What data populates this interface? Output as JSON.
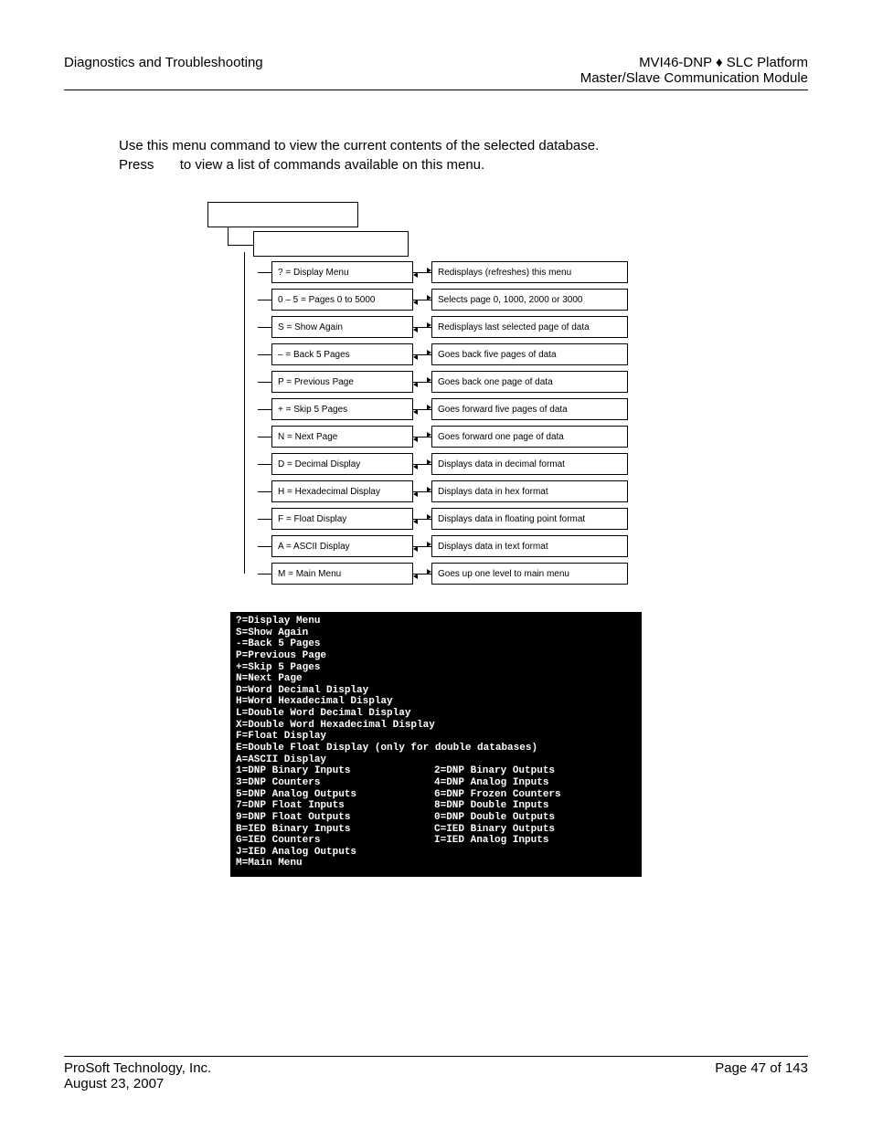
{
  "header": {
    "left": "Diagnostics and Troubleshooting",
    "right_line1": "MVI46-DNP ♦ SLC Platform",
    "right_line2": "Master/Slave Communication Module"
  },
  "intro": {
    "line1": "Use this menu command to view the current contents of the selected database.",
    "line2a": "Press ",
    "line2b": " to view a list of commands available on this menu."
  },
  "menu_rows": [
    {
      "cmd": "? = Display Menu",
      "desc": "Redisplays (refreshes) this menu"
    },
    {
      "cmd": "0 – 5 = Pages 0 to 5000",
      "desc": "Selects page 0, 1000, 2000 or 3000"
    },
    {
      "cmd": "S = Show Again",
      "desc": "Redisplays last selected page of data"
    },
    {
      "cmd": "– = Back 5 Pages",
      "desc": "Goes back five pages of data"
    },
    {
      "cmd": "P = Previous Page",
      "desc": "Goes back one page of data"
    },
    {
      "cmd": "+ = Skip 5 Pages",
      "desc": "Goes forward five pages of data"
    },
    {
      "cmd": "N = Next Page",
      "desc": "Goes forward one page of data"
    },
    {
      "cmd": "D = Decimal Display",
      "desc": "Displays data in decimal format"
    },
    {
      "cmd": "H = Hexadecimal Display",
      "desc": "Displays data in hex format"
    },
    {
      "cmd": "F = Float Display",
      "desc": "Displays data in floating point format"
    },
    {
      "cmd": "A = ASCII Display",
      "desc": "Displays data in text format"
    },
    {
      "cmd": "M = Main Menu",
      "desc": "Goes up one level to main menu"
    }
  ],
  "terminal": {
    "top_lines": [
      "?=Display Menu",
      "S=Show Again",
      "-=Back 5 Pages",
      "P=Previous Page",
      "+=Skip 5 Pages",
      "N=Next Page",
      "D=Word Decimal Display",
      "H=Word Hexadecimal Display",
      "L=Double Word Decimal Display",
      "X=Double Word Hexadecimal Display",
      "F=Float Display",
      "E=Double Float Display (only for double databases)",
      "A=ASCII Display"
    ],
    "col1": [
      "1=DNP Binary Inputs",
      "3=DNP Counters",
      "5=DNP Analog Outputs",
      "7=DNP Float Inputs",
      "9=DNP Float Outputs",
      "B=IED Binary Inputs",
      "G=IED Counters",
      "J=IED Analog Outputs",
      "M=Main Menu"
    ],
    "col2": [
      "2=DNP Binary Outputs",
      "4=DNP Analog Inputs",
      "6=DNP Frozen Counters",
      "8=DNP Double Inputs",
      "0=DNP Double Outputs",
      "C=IED Binary Outputs",
      "I=IED Analog Inputs",
      "",
      ""
    ]
  },
  "footer": {
    "left_line1": "ProSoft Technology, Inc.",
    "left_line2": "August 23, 2007",
    "right": "Page 47 of 143"
  }
}
